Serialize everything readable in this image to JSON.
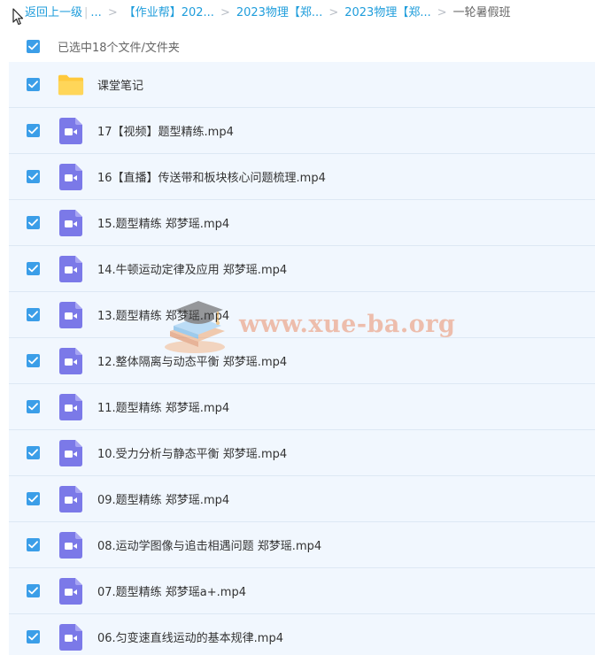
{
  "breadcrumb": {
    "back": "返回上一级",
    "ellipsis": "...",
    "crumb1": "【作业帮】202...",
    "crumb2": "2023物理【郑...",
    "crumb3": "2023物理【郑...",
    "current": "一轮暑假班"
  },
  "selection": {
    "label": "已选中18个文件/文件夹"
  },
  "files": [
    {
      "name": "课堂笔记",
      "type": "folder-icon"
    },
    {
      "name": "17【视频】题型精练.mp4",
      "type": "video-icon"
    },
    {
      "name": "16【直播】传送带和板块核心问题梳理.mp4",
      "type": "video-icon"
    },
    {
      "name": "15.题型精练 郑梦瑶.mp4",
      "type": "video-icon"
    },
    {
      "name": "14.牛顿运动定律及应用 郑梦瑶.mp4",
      "type": "video-icon"
    },
    {
      "name": "13.题型精练 郑梦瑶.mp4",
      "type": "video-icon"
    },
    {
      "name": "12.整体隔离与动态平衡 郑梦瑶.mp4",
      "type": "video-icon"
    },
    {
      "name": "11.题型精练 郑梦瑶.mp4",
      "type": "video-icon"
    },
    {
      "name": "10.受力分析与静态平衡 郑梦瑶.mp4",
      "type": "video-icon"
    },
    {
      "name": "09.题型精练 郑梦瑶.mp4",
      "type": "video-icon"
    },
    {
      "name": "08.运动学图像与追击相遇问题 郑梦瑶.mp4",
      "type": "video-icon"
    },
    {
      "name": "07.题型精练 郑梦瑶a+.mp4",
      "type": "video-icon"
    },
    {
      "name": "06.匀变速直线运动的基本规律.mp4",
      "type": "video-icon"
    }
  ],
  "watermark": {
    "text": "www.xue-ba.org"
  },
  "colors": {
    "link": "#1f9ddb",
    "checkbox": "#3b9ee8",
    "video_icon": "#7b79e8",
    "folder": "#ffd659",
    "row_bg": "#f1f7fe"
  }
}
